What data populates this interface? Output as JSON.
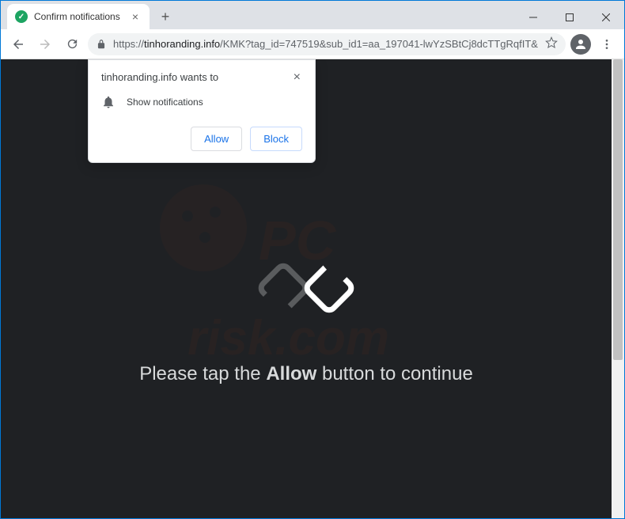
{
  "tab": {
    "title": "Confirm notifications"
  },
  "url": {
    "scheme": "https://",
    "host": "tinhoranding.info",
    "path": "/KMK?tag_id=747519&sub_id1=aa_197041-lwYzSBtCj8dcTTgRqfIT&..."
  },
  "permission_popup": {
    "title": "tinhoranding.info wants to",
    "message": "Show notifications",
    "allow_label": "Allow",
    "block_label": "Block"
  },
  "page": {
    "instruction_prefix": "Please tap the ",
    "instruction_bold": "Allow",
    "instruction_suffix": " button to continue"
  },
  "watermark": {
    "line1": "PC",
    "line2": "risk.com"
  }
}
